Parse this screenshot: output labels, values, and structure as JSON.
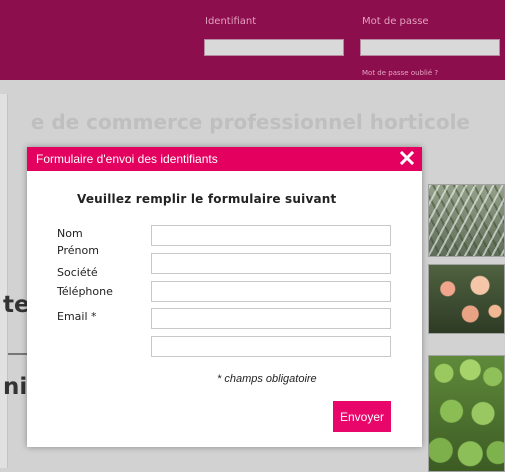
{
  "header": {
    "identifiant_label": "Identifiant",
    "password_label": "Mot de passe",
    "identifiant_value": "",
    "password_value": "",
    "forgot_link": "Mot de passe oublié ?"
  },
  "page": {
    "title": "e de commerce professionnel horticole",
    "fragment_1": "te",
    "fragment_2": "ni"
  },
  "modal": {
    "title": "Formulaire d'envoi des identifiants",
    "close_glyph": "×",
    "heading": "Veuillez remplir le formulaire suivant",
    "fields": [
      {
        "label": "Nom",
        "value": ""
      },
      {
        "label": "Prénom",
        "value": ""
      },
      {
        "label": "Société",
        "value": ""
      },
      {
        "label": "Téléphone",
        "value": ""
      },
      {
        "label": "Email *",
        "value": ""
      }
    ],
    "extra_field_value": "",
    "required_note": "* champs obligatoire",
    "submit_label": "Envoyer"
  },
  "colors": {
    "header_bg": "#8c0e4c",
    "modal_bar": "#e3005e",
    "submit_bg": "#e8066b",
    "page_bg": "#d2d2d2"
  }
}
